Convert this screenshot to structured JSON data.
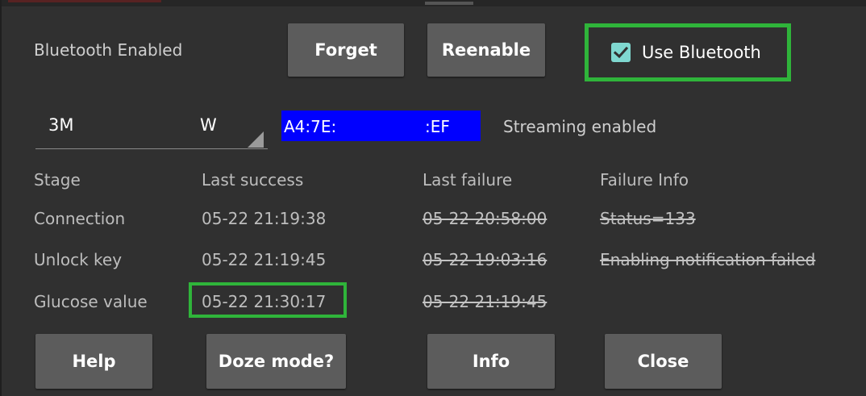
{
  "dialog": {
    "status": "Bluetooth Enabled",
    "buttons": {
      "forget": "Forget",
      "reenable": "Reenable"
    },
    "use_bluetooth": {
      "label": "Use Bluetooth",
      "checked": true
    },
    "device": {
      "name_part_a": "3M",
      "name_part_b": "W",
      "mac_part_a": "A4:7E:",
      "mac_part_b": ":EF",
      "streaming": "Streaming enabled"
    },
    "table": {
      "headers": [
        "Stage",
        "Last success",
        "Last failure",
        "Failure Info"
      ],
      "rows": [
        {
          "stage": "Connection",
          "success": "05-22 21:19:38",
          "failure": "05-22 20:58:00",
          "info": "Status=133"
        },
        {
          "stage": "Unlock key",
          "success": "05-22 21:19:45",
          "failure": "05-22 19:03:16",
          "info": "Enabling notification failed"
        },
        {
          "stage": "Glucose value",
          "success": "05-22 21:30:17",
          "failure": "05-22 21:19:45",
          "info": ""
        }
      ]
    },
    "footer": {
      "help": "Help",
      "doze": "Doze mode?",
      "info": "Info",
      "close": "Close"
    }
  },
  "colors": {
    "background": "#303030",
    "button": "#5c5c5c",
    "highlight": "#2fb43a",
    "mac_field": "#0000ff",
    "checkbox": "#7fd8d0"
  }
}
